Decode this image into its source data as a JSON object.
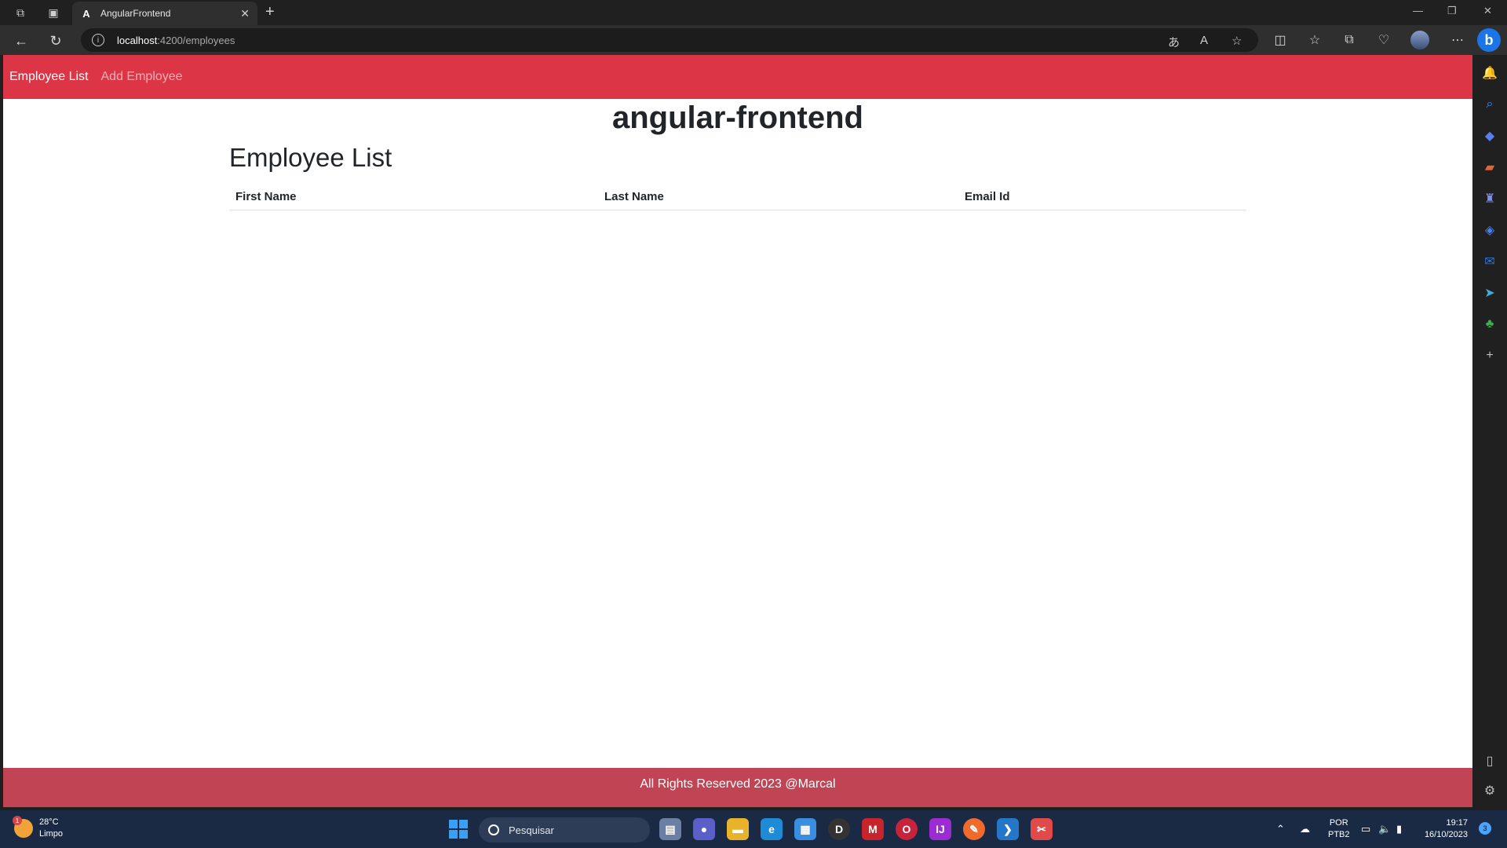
{
  "browser": {
    "tab_title": "AngularFrontend",
    "tab_favicon": "A",
    "url_host": "localhost",
    "url_rest": ":4200/employees"
  },
  "page": {
    "nav": {
      "employee_list": "Employee List",
      "add_employee": "Add Employee"
    },
    "app_title": "angular-frontend",
    "heading": "Employee List",
    "table": {
      "columns": [
        "First Name",
        "Last Name",
        "Email Id"
      ],
      "rows": []
    },
    "footer": "All Rights Reserved 2023 @Marcal",
    "colors": {
      "navbar": "#dc3545",
      "footer": "#c14455"
    }
  },
  "taskbar": {
    "weather_temp": "28°C",
    "weather_desc": "Limpo",
    "weather_badge": "1",
    "search_placeholder": "Pesquisar",
    "lang_1": "POR",
    "lang_2": "PTB2",
    "time": "19:17",
    "date": "16/10/2023",
    "notifications": "3"
  }
}
